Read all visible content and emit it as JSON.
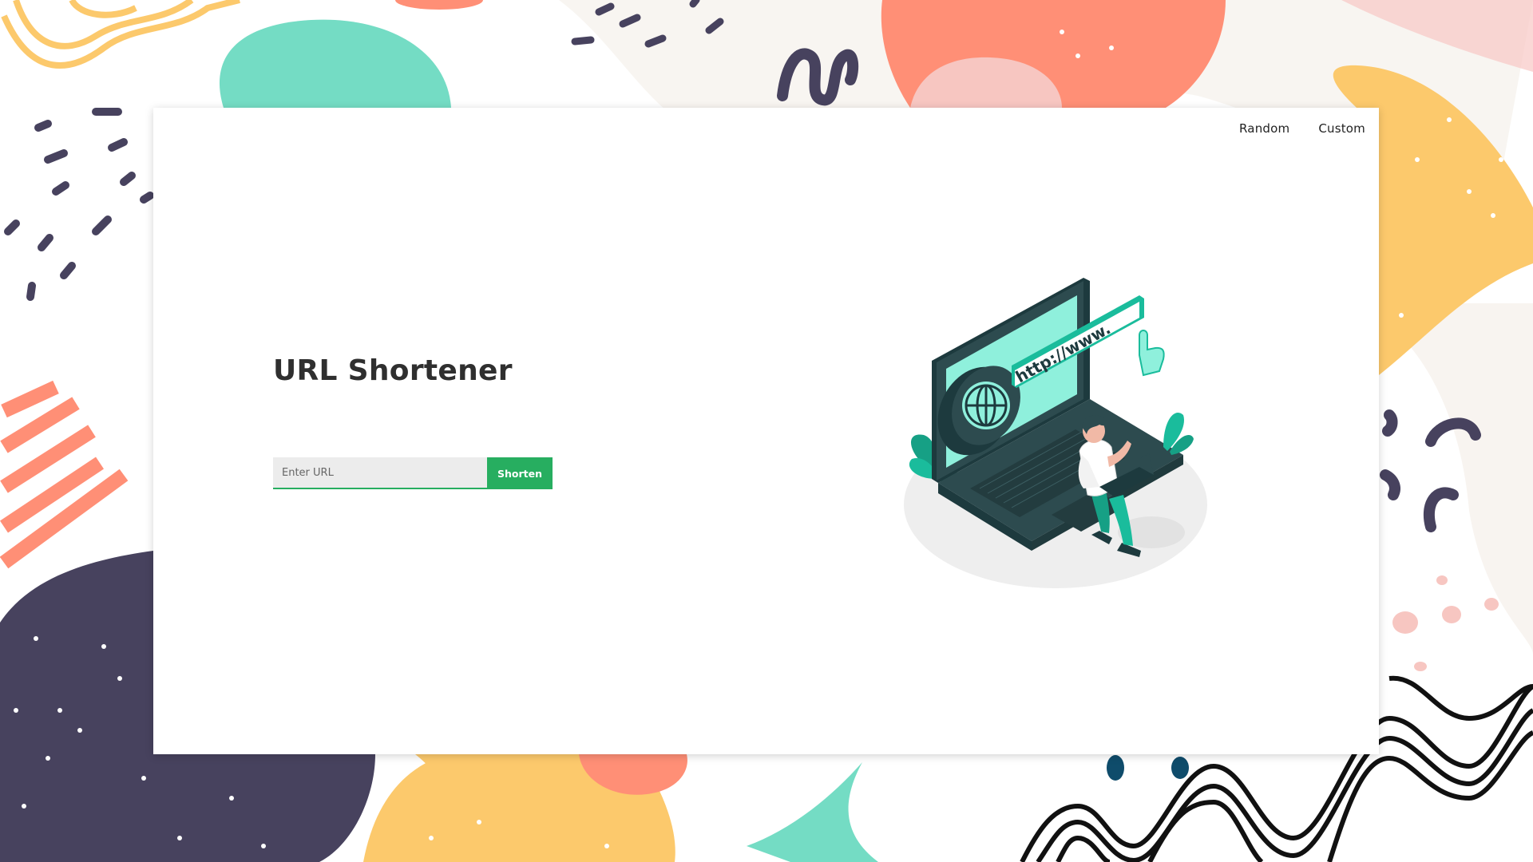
{
  "nav": {
    "random_label": "Random",
    "custom_label": "Custom"
  },
  "main": {
    "title": "URL Shortener",
    "url_input": {
      "placeholder": "Enter URL",
      "value": ""
    },
    "shorten_label": "Shorten",
    "illustration": {
      "url_banner_text": "http://www."
    }
  },
  "colors": {
    "accent_green": "#27ae60",
    "teal": "#1abc9c",
    "mint_screen": "#8ff0dc",
    "laptop_dark": "#2d4b4f",
    "bg_yellow": "#fcc96c",
    "bg_coral": "#ff8f76",
    "bg_navy": "#47425e",
    "bg_mint": "#74dcc4",
    "bg_pink": "#f7c6c1"
  }
}
